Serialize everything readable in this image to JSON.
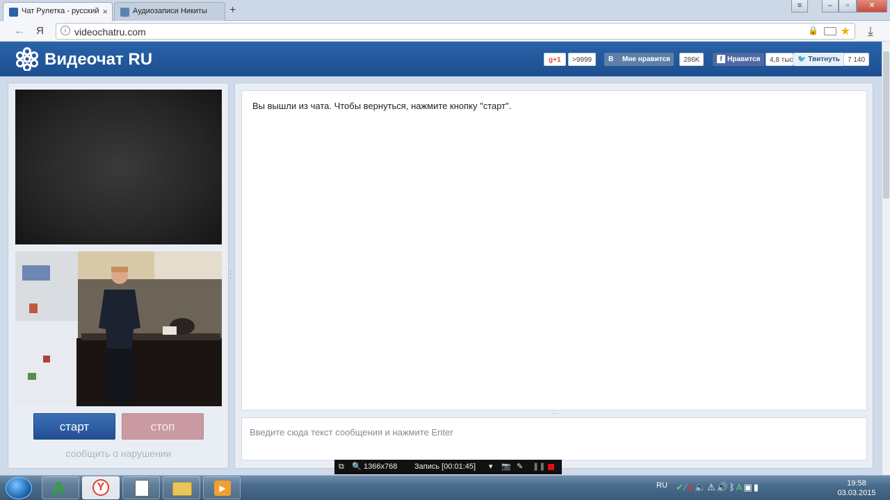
{
  "browser": {
    "tabs": [
      {
        "title": "Чат Рулетка - русский",
        "active": true
      },
      {
        "title": "Аудиозаписи Никиты",
        "active": false
      }
    ],
    "url": "videochatru.com",
    "back_glyph": "←",
    "yandex_glyph": "Я",
    "download_glyph": "⤓"
  },
  "site": {
    "logo_text": "Видеочат RU",
    "social": {
      "gplus_label": "g+1",
      "gplus_count": ">9999",
      "vk_icon": "B",
      "vk_label": "Мне нравится",
      "vk_count": "286K",
      "fb_label": "Нравится",
      "fb_count": "4,8 тыс",
      "tw_label": "Твитнуть",
      "tw_count": "7 140"
    }
  },
  "controls": {
    "start_label": "старт",
    "stop_label": "стоп",
    "report_label": "сообщить о нарушении"
  },
  "chat": {
    "status_message": "Вы вышли из чата. Чтобы вернуться, нажмите кнопку \"старт\".",
    "input_placeholder": "Введите сюда текст сообщения и нажмите Enter"
  },
  "recorder": {
    "resolution": "1366x768",
    "status": "Запись [00:01:45]"
  },
  "taskbar": {
    "language": "RU",
    "time": "19:58",
    "date": "03.03.2015"
  },
  "colors": {
    "header_blue": "#2a63a9",
    "start_button": "#2f5ea6",
    "stop_button": "#c99aa1"
  }
}
